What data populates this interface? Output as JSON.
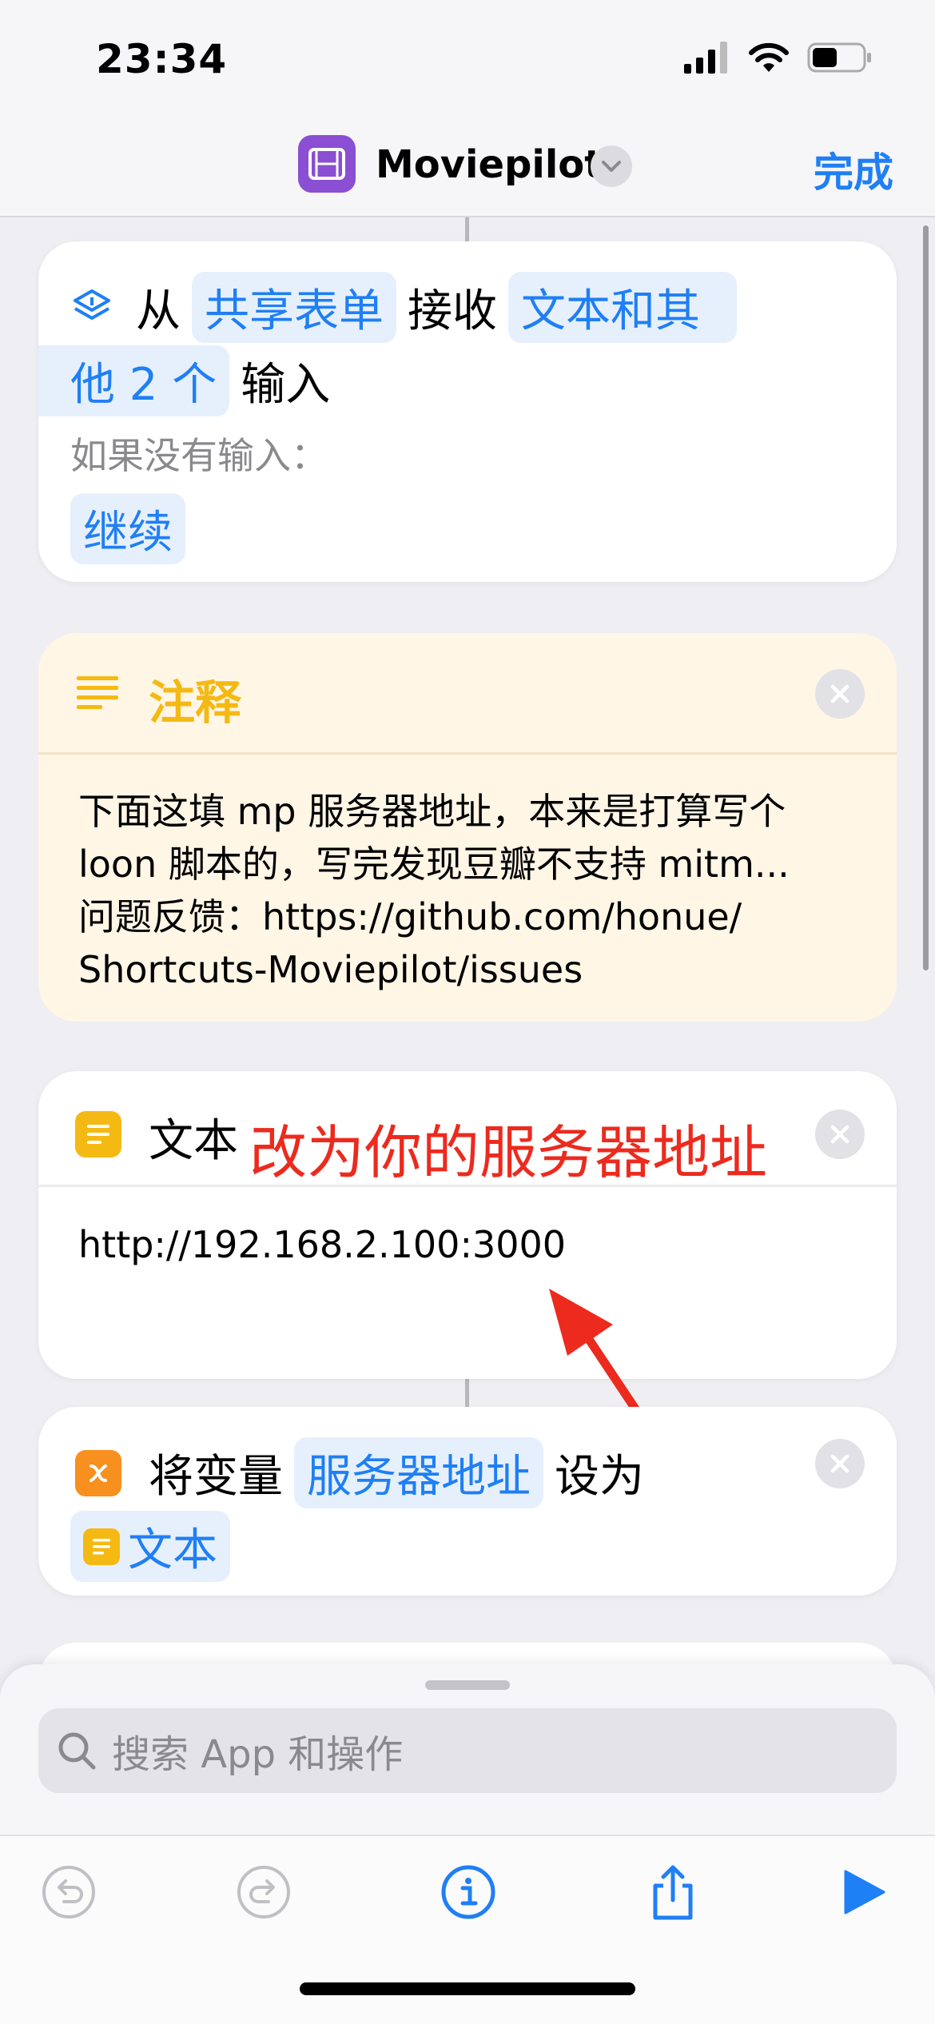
{
  "status": {
    "time": "23:34"
  },
  "nav": {
    "title": "Moviepilot",
    "done": "完成"
  },
  "receive": {
    "from": "从",
    "source": "共享表单",
    "receive": "接收",
    "type_part1": "文本和其",
    "type_part2": "他 2 个",
    "input": "输入",
    "if_none": "如果没有输入：",
    "continue": "继续"
  },
  "comment": {
    "title": "注释",
    "lines": [
      "下面这填 mp 服务器地址，本来是打算写个",
      "loon 脚本的，写完发现豆瓣不支持 mitm...",
      "问题反馈：https://github.com/honue/",
      "Shortcuts-Moviepilot/issues"
    ]
  },
  "text_action": {
    "title": "文本",
    "value": "http://192.168.2.100:3000"
  },
  "annotation": {
    "label": "改为你的服务器地址",
    "color": "#ec2a1e"
  },
  "set_var": {
    "set": "将变量",
    "var": "服务器地址",
    "to": "设为",
    "value": "文本"
  },
  "search": {
    "placeholder": "搜索 App 和操作"
  },
  "toolbar": {
    "icons": [
      "undo-icon",
      "redo-icon",
      "info-icon",
      "share-icon",
      "play-icon"
    ]
  },
  "colors": {
    "accent": "#1f7ff5",
    "comment_yellow": "#f5b914",
    "app_purple": "#8a4fd2",
    "variable_orange": "#f7901e"
  }
}
